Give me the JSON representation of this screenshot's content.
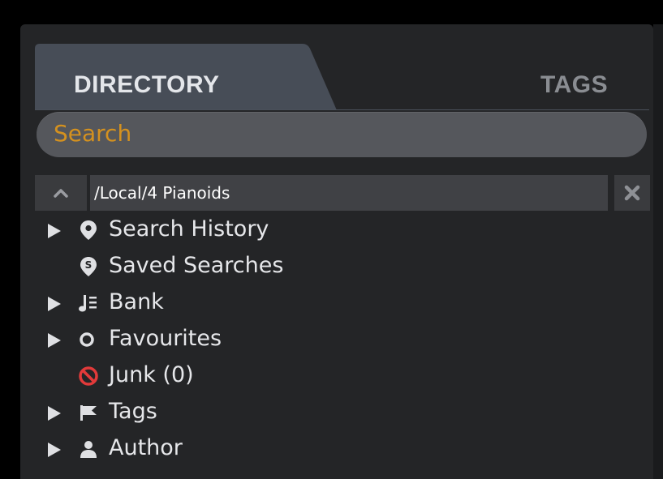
{
  "tabs": {
    "directory_label": "DIRECTORY",
    "tags_label": "TAGS"
  },
  "search": {
    "placeholder": "Search"
  },
  "path_bar": {
    "path": "/Local/4 Pianoids"
  },
  "tree": {
    "items": [
      {
        "label": "Search History",
        "icon": "location-pin-icon",
        "expandable": true
      },
      {
        "label": "Saved Searches",
        "icon": "saved-search-pin-icon",
        "expandable": false
      },
      {
        "label": "Bank",
        "icon": "music-note-list-icon",
        "expandable": true
      },
      {
        "label": "Favourites",
        "icon": "ring-icon",
        "expandable": true
      },
      {
        "label": "Junk (0)",
        "icon": "prohibited-icon",
        "expandable": false
      },
      {
        "label": "Tags",
        "icon": "flag-icon",
        "expandable": true
      },
      {
        "label": "Author",
        "icon": "person-icon",
        "expandable": true
      }
    ]
  },
  "colors": {
    "panel_bg": "#242527",
    "active_tab": "#474d57",
    "search_bg": "#55575c",
    "search_placeholder": "#d4911f",
    "junk_icon": "#e23a3a",
    "text": "#e6e7ea"
  }
}
